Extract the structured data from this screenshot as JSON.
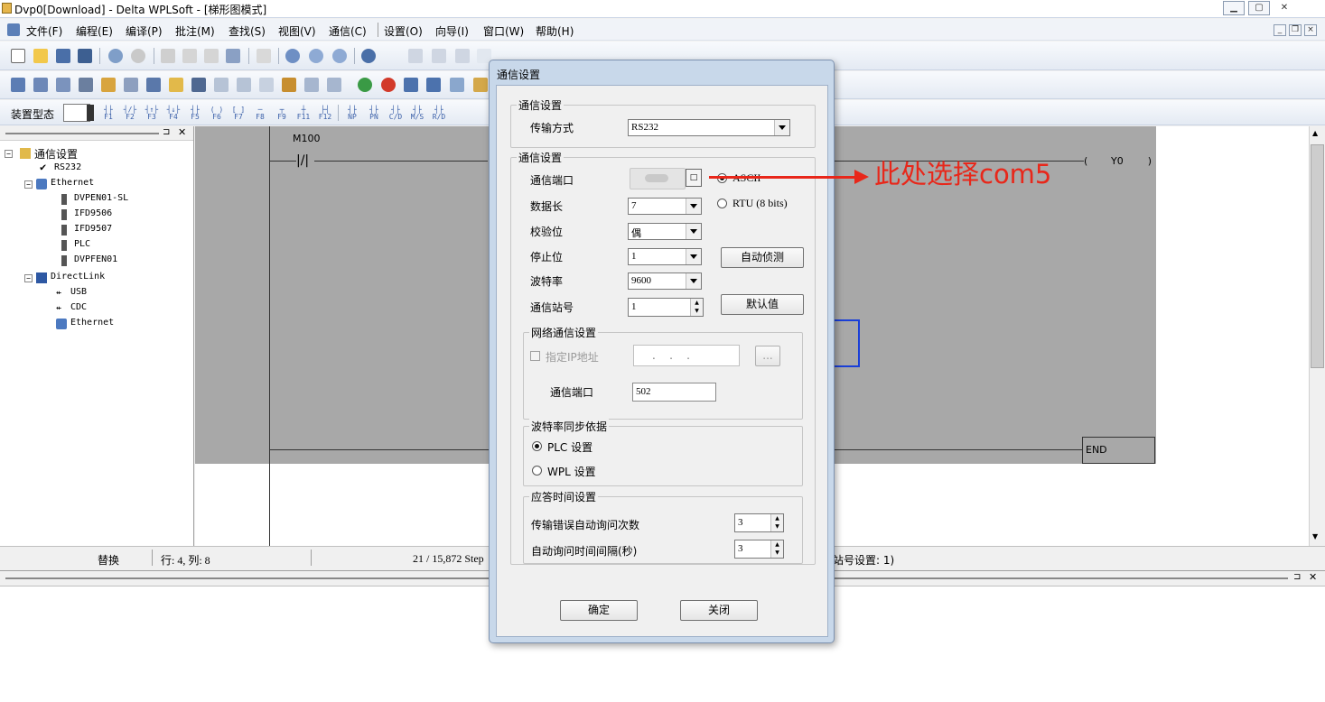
{
  "window": {
    "title": "Dvp0[Download] - Delta WPLSoft - [梯形图模式]"
  },
  "menu": [
    {
      "label": "文件(F)"
    },
    {
      "label": "编程(E)"
    },
    {
      "label": "编译(P)"
    },
    {
      "label": "批注(M)"
    },
    {
      "label": "查找(S)"
    },
    {
      "label": "视图(V)"
    },
    {
      "label": "通信(C)"
    },
    {
      "label": "设置(O)"
    },
    {
      "label": "向导(I)"
    },
    {
      "label": "窗口(W)"
    },
    {
      "label": "帮助(H)"
    }
  ],
  "toolbar3": {
    "device_label": "装置型态",
    "fkeys": [
      "F1",
      "F2",
      "F3",
      "F4",
      "F5",
      "F6",
      "F7",
      "F8",
      "F9",
      "F11",
      "F12",
      "NP",
      "PN",
      "C/D",
      "M/S",
      "R/D"
    ]
  },
  "tree": {
    "nodes": [
      {
        "label": "通信设置",
        "icon": "comm-settings-icon"
      },
      {
        "label": "RS232",
        "icon": "checkmark-icon"
      },
      {
        "label": "Ethernet",
        "icon": "network-icon"
      },
      {
        "label": "DVPEN01-SL",
        "icon": "module-icon"
      },
      {
        "label": "IFD9506",
        "icon": "module-icon"
      },
      {
        "label": "IFD9507",
        "icon": "module-icon"
      },
      {
        "label": "PLC",
        "icon": "module-icon"
      },
      {
        "label": "DVPFEN01",
        "icon": "module-icon"
      },
      {
        "label": "DirectLink",
        "icon": "directlink-icon"
      },
      {
        "label": "USB",
        "icon": "usb-icon"
      },
      {
        "label": "CDC",
        "icon": "usb-icon"
      },
      {
        "label": "Ethernet",
        "icon": "network-icon"
      }
    ]
  },
  "ladder": {
    "contact_label": "M100",
    "coil_label": "Y0",
    "end_label": "END"
  },
  "status": {
    "mode": "替换",
    "position": "行: 4, 列: 8",
    "steps": "21 / 15,872 Step",
    "station": "站号设置: 1)"
  },
  "dialog": {
    "title": "通信设置",
    "group1": {
      "title": "通信设置",
      "transfer_label": "传输方式",
      "transfer_value": "RS232"
    },
    "group2": {
      "title": "通信设置",
      "port_label": "通信端口",
      "data_length_label": "数据长",
      "data_length_value": "7",
      "parity_label": "校验位",
      "parity_value": "偶",
      "stop_bits_label": "停止位",
      "stop_bits_value": "1",
      "baud_label": "波特率",
      "baud_value": "9600",
      "station_label": "通信站号",
      "station_value": "1",
      "mode_ascii": "ASCII",
      "mode_rtu": "RTU (8 bits)",
      "auto_detect": "自动侦测",
      "default": "默认值"
    },
    "network": {
      "title": "网络通信设置",
      "ip_checkbox_label": "指定IP地址",
      "ip_value": ".    .    .",
      "browse": "...",
      "port_label": "通信端口",
      "port_value": "502"
    },
    "baud_sync": {
      "title": "波特率同步依据",
      "plc": "PLC 设置",
      "wpl": "WPL 设置"
    },
    "response": {
      "title": "应答时间设置",
      "retry_label": "传输错误自动询问次数",
      "retry_value": "3",
      "interval_label": "自动询问时间间隔(秒)",
      "interval_value": "3"
    },
    "ok": "确定",
    "close": "关闭"
  },
  "annotation": {
    "text": "此处选择com5",
    "color": "#e8271a"
  }
}
